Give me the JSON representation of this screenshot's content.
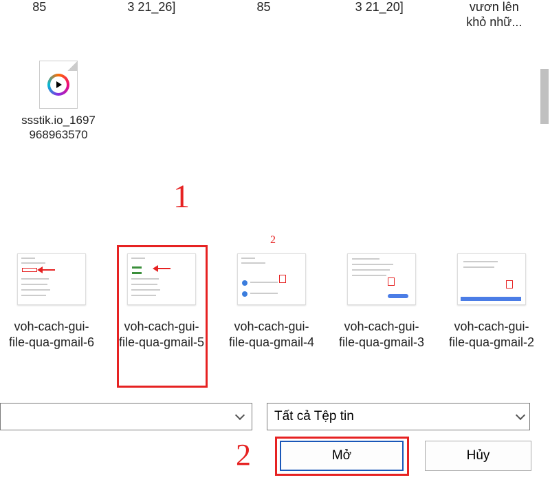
{
  "partial_row": [
    "85",
    "3 21_26]",
    "85",
    "3 21_20]",
    "vươn lên khỏ nhữ..."
  ],
  "video_file": {
    "name": "ssstik.io_1697968963570"
  },
  "thumbs": [
    {
      "name": "voh-cach-gui-file-qua-gmail-6"
    },
    {
      "name": "voh-cach-gui-file-qua-gmail-5"
    },
    {
      "name": "voh-cach-gui-file-qua-gmail-4"
    },
    {
      "name": "voh-cach-gui-file-qua-gmail-3"
    },
    {
      "name": "voh-cach-gui-file-qua-gmail-2"
    }
  ],
  "selected_index": 1,
  "annotations": {
    "label1": "1",
    "label1b": "2",
    "label2": "2"
  },
  "filename_value": "",
  "filetype_label": "Tất cả Tệp tin",
  "buttons": {
    "open": "Mở",
    "cancel": "Hủy"
  }
}
